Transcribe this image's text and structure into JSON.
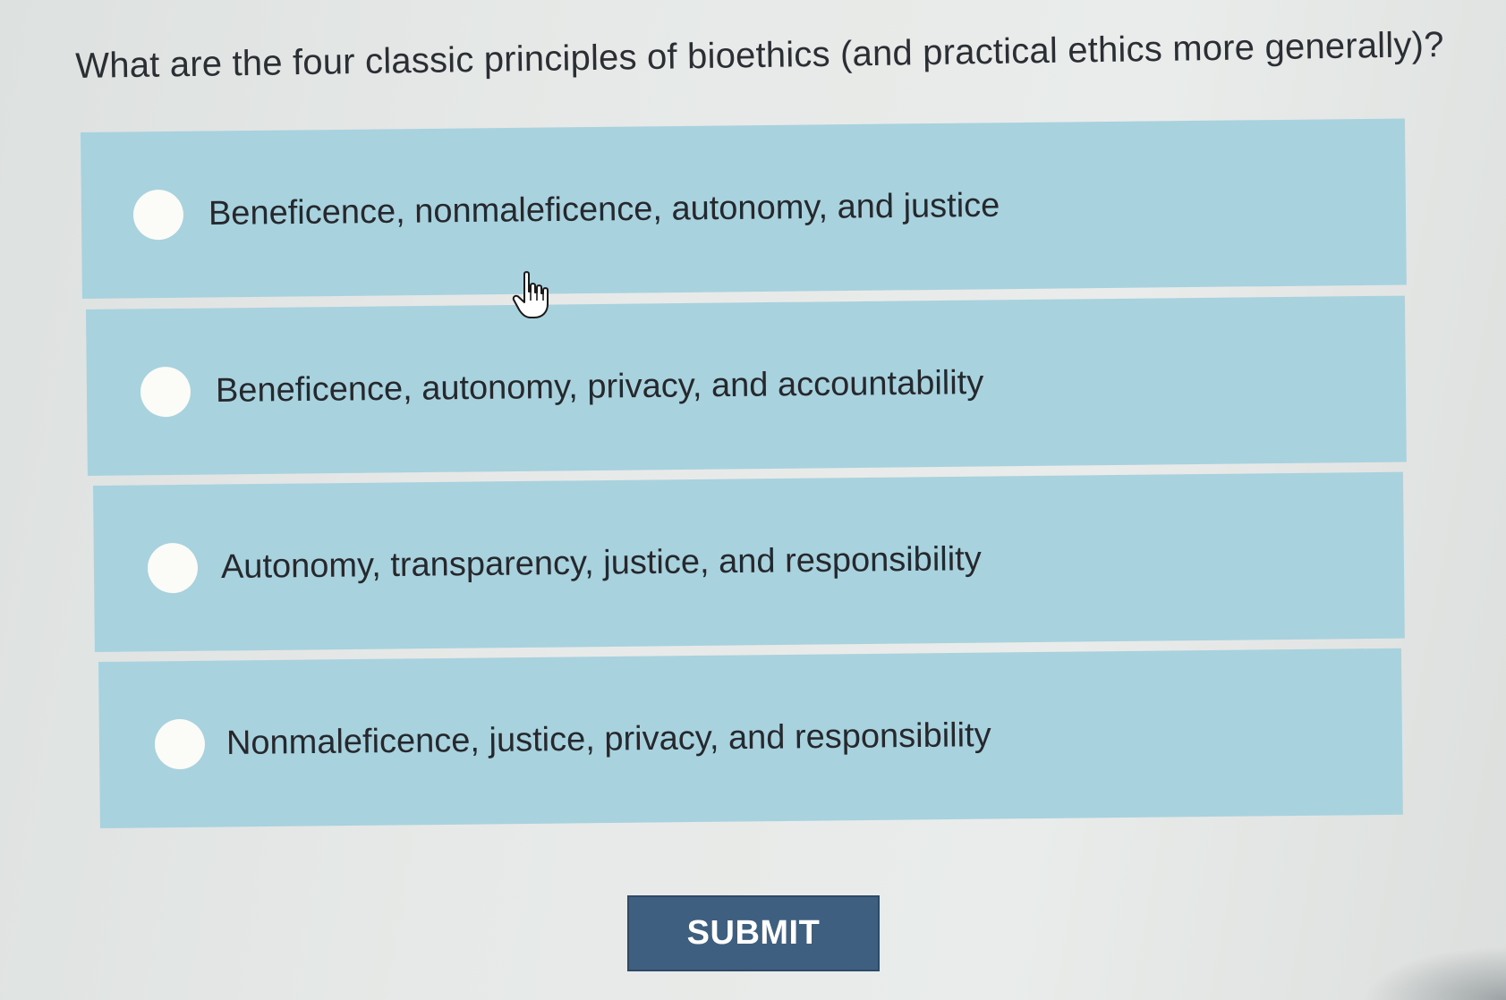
{
  "question": {
    "text": "What are the four classic principles of bioethics (and practical ethics more generally)?"
  },
  "options": [
    {
      "label": "Beneficence, nonmaleficence, autonomy, and justice",
      "selected": false
    },
    {
      "label": "Beneficence, autonomy, privacy, and accountability",
      "selected": false
    },
    {
      "label": "Autonomy, transparency, justice, and responsibility",
      "selected": false
    },
    {
      "label": "Nonmaleficence, justice, privacy, and responsibility",
      "selected": false
    }
  ],
  "submit": {
    "label": "SUBMIT"
  },
  "colors": {
    "option_background": "#a9d2df",
    "submit_background": "#3e5f7f",
    "radio_fill": "#fbfbf8",
    "page_background": "#e6e9e7"
  },
  "icons": {
    "cursor": "hand-pointer-icon",
    "radio": "radio-button-icon"
  }
}
